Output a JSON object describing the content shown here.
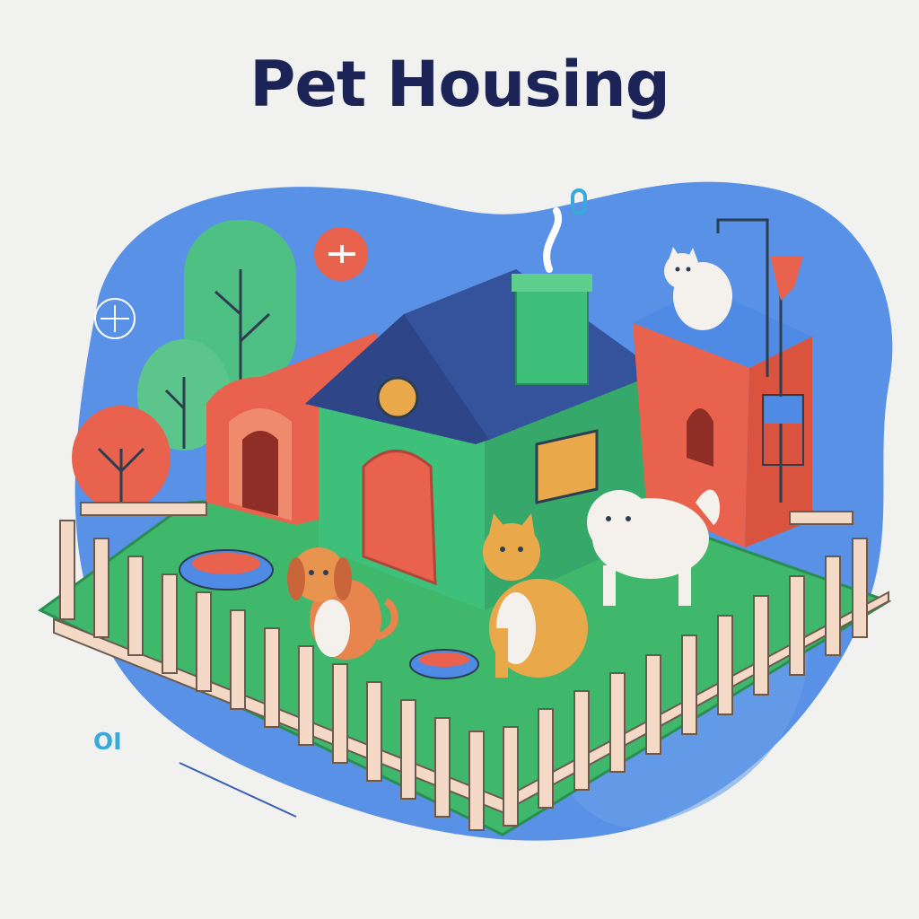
{
  "title": "Pet Housing",
  "deco_text": "OI",
  "colors": {
    "title": "#1c2457",
    "background": "#f1f1ef",
    "blob": "#4f8be4",
    "grass": "#3fb86b",
    "house_wall": "#3ec07a",
    "roof": "#35529d",
    "kennel": "#e8624e",
    "fence": "#f3d9c6",
    "accent": "#e9a94b"
  },
  "icons": [
    "dog-icon",
    "cat-icon",
    "food-bowl-icon",
    "water-bowl-icon",
    "tree-icon",
    "fence-icon",
    "lamp-post-icon",
    "bird-feeder-icon"
  ]
}
